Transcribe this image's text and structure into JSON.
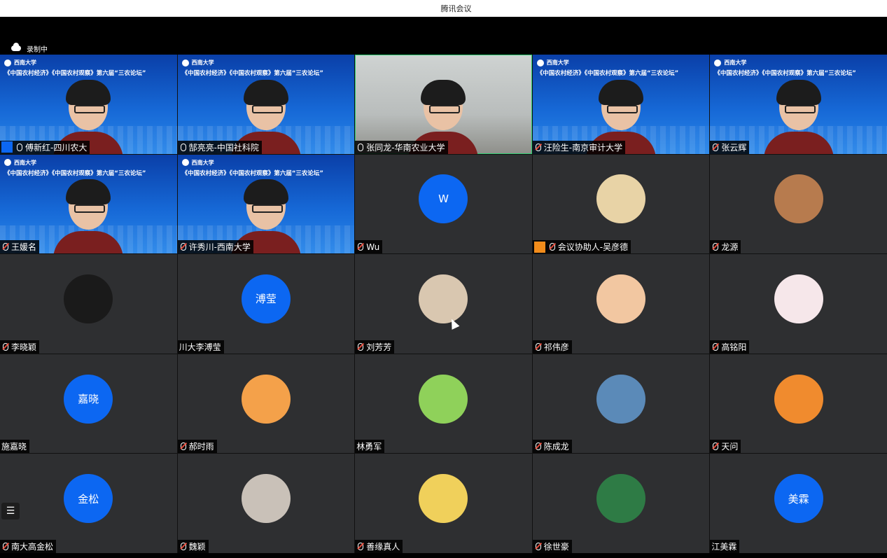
{
  "window": {
    "title": "腾讯会议"
  },
  "recording": {
    "label": "录制中",
    "icon": "cloud-icon"
  },
  "banner": {
    "logo_text": "西南大学",
    "title": "《中国农村经济》《中国农村观察》第六届“三农论坛”"
  },
  "participants": [
    {
      "name": "傅新红-四川农大",
      "kind": "video",
      "host": true
    },
    {
      "name": "郜亮亮-中国社科院",
      "kind": "video"
    },
    {
      "name": "张同龙-华南农业大学",
      "kind": "room",
      "active": true
    },
    {
      "name": "汪险生-南京审计大学",
      "kind": "video"
    },
    {
      "name": "张云辉",
      "kind": "video"
    },
    {
      "name": "王媛名",
      "kind": "video"
    },
    {
      "name": "许秀川-西南大学",
      "kind": "video"
    },
    {
      "name": "Wu",
      "kind": "avatar",
      "avatar_text": "W"
    },
    {
      "name": "会议协助人-吴彦德",
      "kind": "avatar",
      "cohost": true,
      "avatar_icon": "dog-icon"
    },
    {
      "name": "龙源",
      "kind": "avatar",
      "avatar_icon": "cartoon-man-icon"
    },
    {
      "name": "李晓颖",
      "kind": "avatar",
      "avatar_icon": "portrait-icon"
    },
    {
      "name": "川大李溥莹",
      "kind": "avatar",
      "avatar_text": "溥莹",
      "nomic": true
    },
    {
      "name": "刘芳芳",
      "kind": "avatar",
      "avatar_icon": "plush-dog-icon"
    },
    {
      "name": "祁伟彦",
      "kind": "avatar",
      "avatar_icon": "child-photo-icon"
    },
    {
      "name": "高铭阳",
      "kind": "avatar",
      "avatar_icon": "reading-cartoon-icon"
    },
    {
      "name": "施嘉晓",
      "kind": "avatar",
      "avatar_text": "嘉晓",
      "nomic": true
    },
    {
      "name": "郝时雨",
      "kind": "avatar",
      "avatar_icon": "tiger-icon"
    },
    {
      "name": "林勇军",
      "kind": "avatar",
      "avatar_icon": "frog-icon",
      "nomic": true
    },
    {
      "name": "陈成龙",
      "kind": "avatar",
      "avatar_icon": "mountain-icon"
    },
    {
      "name": "天问",
      "kind": "avatar",
      "avatar_icon": "sunset-icon"
    },
    {
      "name": "南大高金松",
      "kind": "avatar",
      "avatar_text": "金松"
    },
    {
      "name": "魏颖",
      "kind": "avatar",
      "avatar_icon": "woman-photo-icon"
    },
    {
      "name": "善缘真人",
      "kind": "avatar",
      "avatar_icon": "mandala-icon"
    },
    {
      "name": "徐世豪",
      "kind": "avatar",
      "avatar_icon": "cube-icon"
    },
    {
      "name": "江美霖",
      "kind": "avatar",
      "avatar_text": "美霖",
      "nomic": true
    }
  ],
  "toolbar": {
    "menu_icon": "list-icon"
  }
}
